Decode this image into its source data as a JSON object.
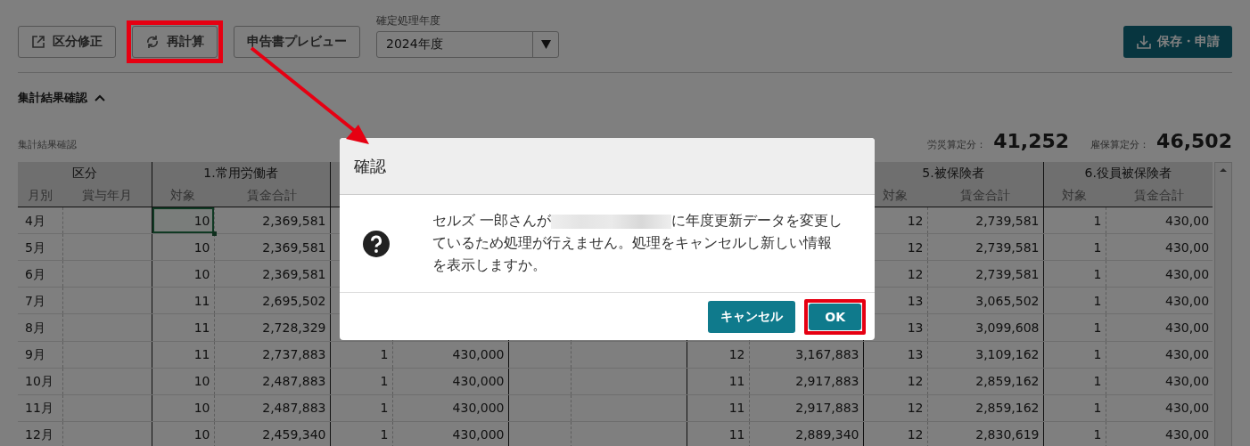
{
  "toolbar": {
    "buttons": [
      {
        "label": "区分修正",
        "kind": "edit",
        "highlighted": false
      },
      {
        "label": "再計算",
        "kind": "recalc",
        "highlighted": true
      },
      {
        "label": "申告書プレビュー",
        "kind": "plain",
        "highlighted": false
      }
    ],
    "year_select": {
      "label": "確定処理年度",
      "value": "2024年度"
    },
    "save_button": {
      "label": "保存・申請"
    }
  },
  "section": {
    "title": "集計結果確認",
    "expanded": true
  },
  "summary": {
    "caption": "集計結果確認",
    "totals": [
      {
        "label": "労災算定分：",
        "value": "41,252"
      },
      {
        "label": "雇保算定分：",
        "value": "46,502"
      }
    ]
  },
  "table": {
    "left_groups": [
      {
        "title": "区分",
        "columns": [
          "月別",
          "賞与年月"
        ]
      },
      {
        "title": "1.常用労働者",
        "columns": [
          "対象",
          "賃金合計"
        ]
      }
    ],
    "right_groups": [
      {
        "title": "5.被保険者",
        "columns": [
          "対象",
          "賃金合計"
        ]
      },
      {
        "title": "6.役員被保険者",
        "columns": [
          "対象",
          "賃金合計"
        ]
      }
    ],
    "rows": [
      {
        "selected": true,
        "cells": [
          "4月",
          null,
          "10",
          "2,369,581",
          null,
          null,
          null,
          null,
          null,
          null,
          "12",
          "2,739,581",
          "1",
          "430,00"
        ]
      },
      {
        "selected": false,
        "cells": [
          "5月",
          null,
          "10",
          "2,369,581",
          null,
          null,
          null,
          null,
          null,
          null,
          "12",
          "2,739,581",
          "1",
          "430,00"
        ]
      },
      {
        "selected": false,
        "cells": [
          "6月",
          null,
          "10",
          "2,369,581",
          null,
          null,
          null,
          null,
          null,
          null,
          "12",
          "2,739,581",
          "1",
          "430,00"
        ]
      },
      {
        "selected": false,
        "cells": [
          "7月",
          null,
          "11",
          "2,695,502",
          null,
          null,
          null,
          null,
          null,
          null,
          "13",
          "3,065,502",
          "1",
          "430,00"
        ]
      },
      {
        "selected": false,
        "cells": [
          "8月",
          null,
          "11",
          "2,728,329",
          null,
          null,
          null,
          null,
          null,
          null,
          "13",
          "3,099,608",
          "1",
          "430,00"
        ]
      },
      {
        "selected": false,
        "cells": [
          "9月",
          null,
          "11",
          "2,737,883",
          "1",
          "430,000",
          null,
          null,
          "12",
          "3,167,883",
          "13",
          "3,109,162",
          "1",
          "430,00"
        ]
      },
      {
        "selected": false,
        "cells": [
          "10月",
          null,
          "10",
          "2,487,883",
          "1",
          "430,000",
          null,
          null,
          "11",
          "2,917,883",
          "12",
          "2,859,162",
          "1",
          "430,00"
        ]
      },
      {
        "selected": false,
        "cells": [
          "11月",
          null,
          "10",
          "2,487,883",
          "1",
          "430,000",
          null,
          null,
          "11",
          "2,917,883",
          "12",
          "2,859,162",
          "1",
          "430,00"
        ]
      },
      {
        "selected": false,
        "cells": [
          "12月",
          null,
          "10",
          "2,459,340",
          "1",
          "430,000",
          null,
          null,
          "11",
          "2,889,340",
          "12",
          "2,830,619",
          "1",
          "430,00"
        ]
      }
    ]
  },
  "dialog": {
    "title": "確認",
    "message_parts": [
      "セルズ 一郎さんが",
      "に年度更新データを変更しているため処理が行えません。処理をキャンセルし新しい情報を表示しますか。"
    ],
    "buttons": [
      {
        "label": "キャンセル",
        "highlighted": false
      },
      {
        "label": "OK",
        "highlighted": true
      }
    ]
  }
}
